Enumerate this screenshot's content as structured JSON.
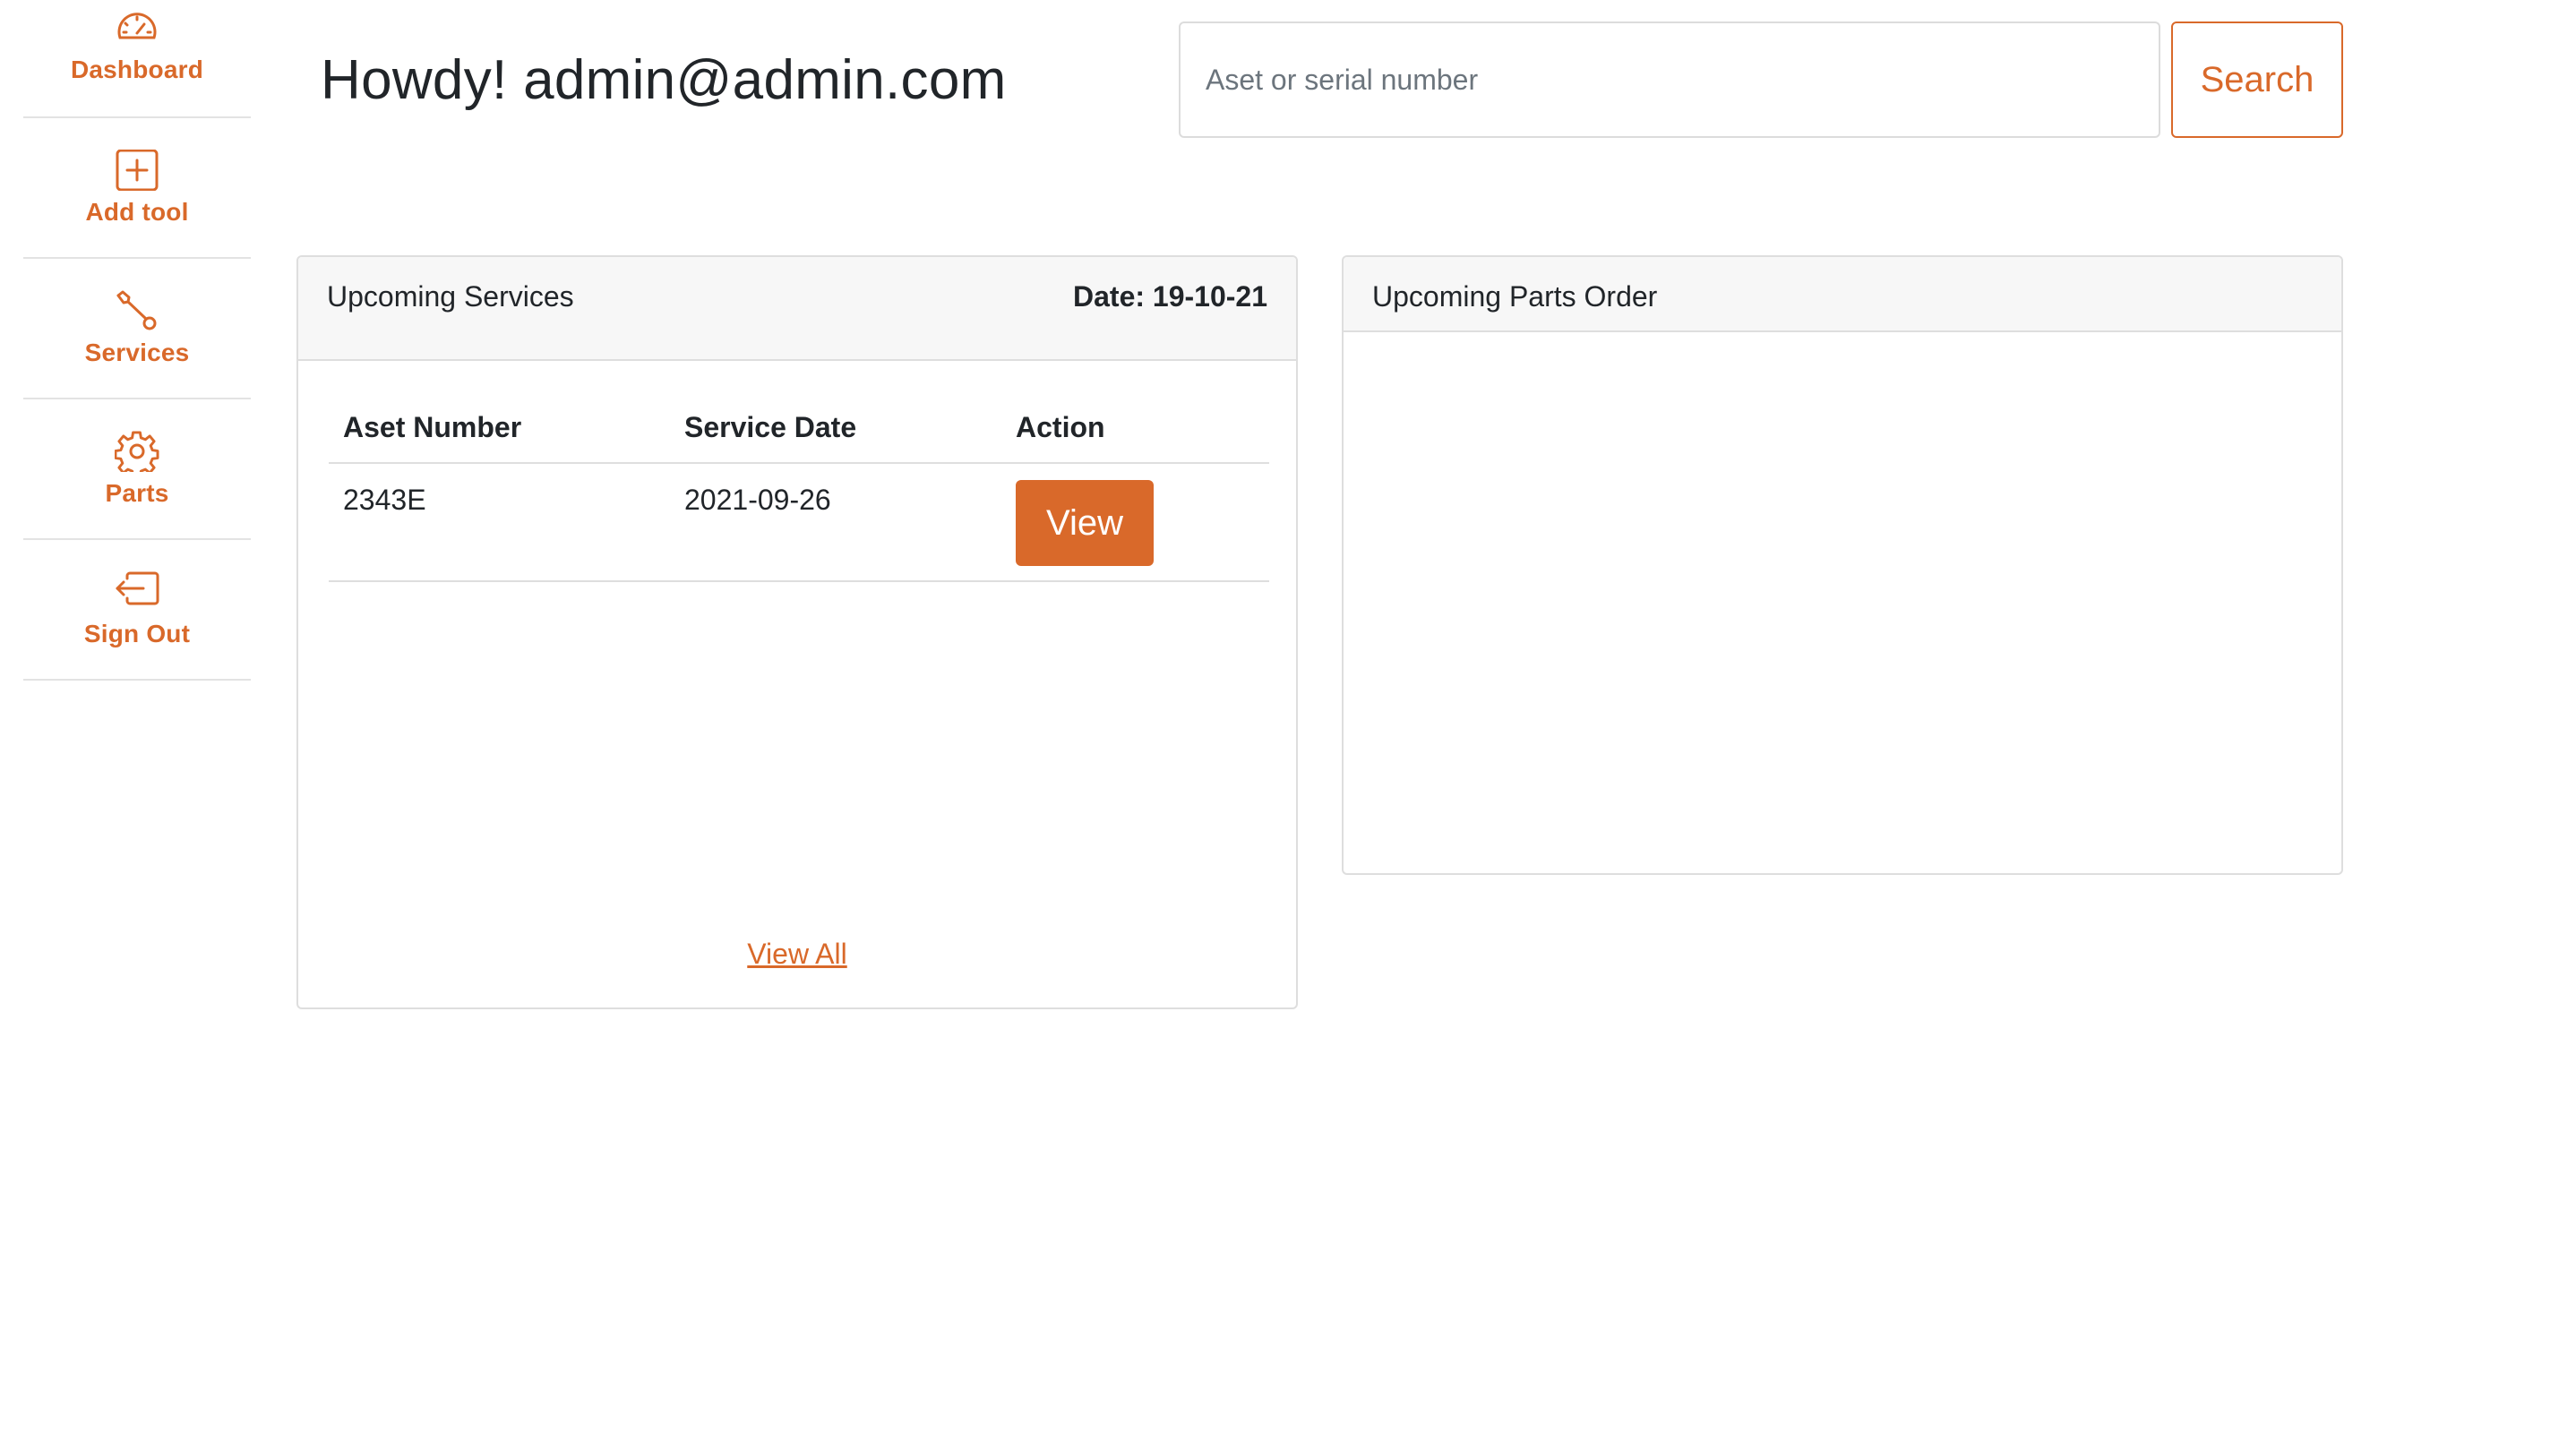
{
  "sidebar": {
    "items": [
      {
        "label": "Dashboard",
        "icon": "speedometer-icon"
      },
      {
        "label": "Add tool",
        "icon": "plus-square-icon"
      },
      {
        "label": "Services",
        "icon": "wrench-icon"
      },
      {
        "label": "Parts",
        "icon": "gear-icon"
      },
      {
        "label": "Sign Out",
        "icon": "box-arrow-left-icon"
      }
    ]
  },
  "header": {
    "greeting": "Howdy! admin@admin.com",
    "search": {
      "placeholder": "Aset or serial number",
      "value": "",
      "button_label": "Search"
    }
  },
  "services_card": {
    "title": "Upcoming Services",
    "date_label": "Date: 19-10-21",
    "columns": [
      "Aset Number",
      "Service Date",
      "Action"
    ],
    "rows": [
      {
        "asset_number": "2343E",
        "service_date": "2021-09-26",
        "action_label": "View"
      }
    ],
    "view_all_label": "View All"
  },
  "parts_card": {
    "title": "Upcoming Parts Order"
  },
  "colors": {
    "accent": "#d9692a",
    "border": "#dedede",
    "header_bg": "#f7f7f7"
  }
}
